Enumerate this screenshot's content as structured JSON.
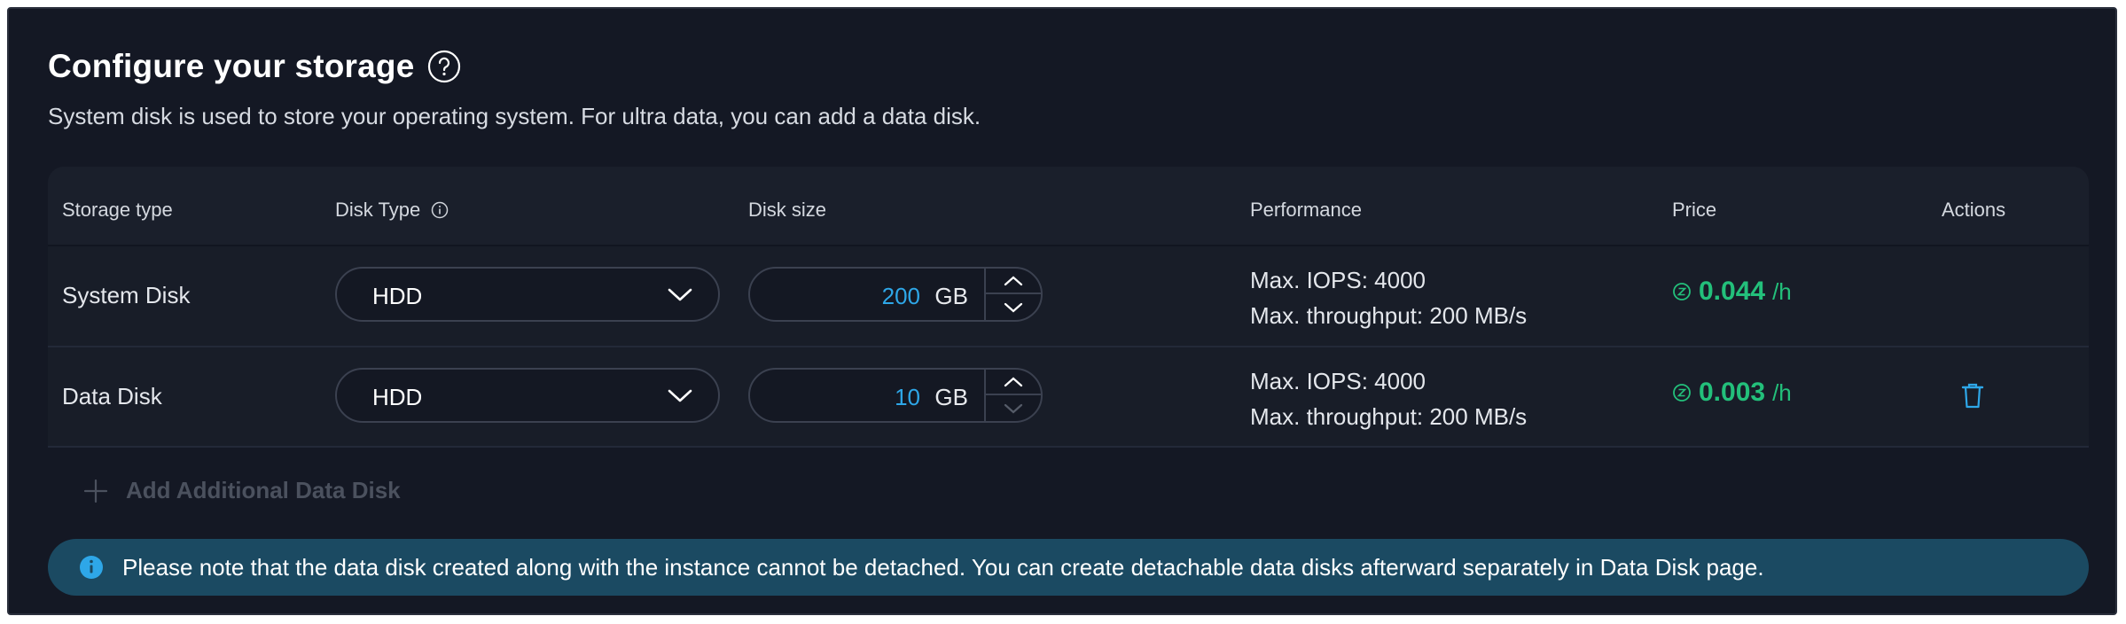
{
  "header": {
    "title": "Configure your storage",
    "subtitle": "System disk is used to store your operating system. For ultra data, you can add a data disk."
  },
  "table": {
    "columns": {
      "storage_type": "Storage type",
      "disk_type": "Disk Type",
      "disk_size": "Disk size",
      "performance": "Performance",
      "price": "Price",
      "actions": "Actions"
    },
    "rows": [
      {
        "storage_type": "System Disk",
        "disk_type": "HDD",
        "disk_size": "200",
        "unit": "GB",
        "iops": "Max. IOPS: 4000",
        "throughput": "Max. throughput: 200 MB/s",
        "price": "0.044",
        "price_unit": "/h"
      },
      {
        "storage_type": "Data Disk",
        "disk_type": "HDD",
        "disk_size": "10",
        "unit": "GB",
        "iops": "Max. IOPS: 4000",
        "throughput": "Max. throughput: 200 MB/s",
        "price": "0.003",
        "price_unit": "/h"
      }
    ]
  },
  "add_disk_label": "Add Additional Data Disk",
  "notice": "Please note that the data disk created along with the instance cannot be detached. You can create detachable data disks afterward separately in Data Disk page.",
  "colors": {
    "background": "#141824",
    "accent_blue": "#2ea7e8",
    "price_green": "#23c07b",
    "notice_bg": "#1b4a62"
  },
  "icons": [
    "help-icon",
    "info-icon",
    "chevron-down-icon",
    "chevron-up-icon",
    "coin-icon",
    "trash-icon",
    "plus-icon"
  ]
}
